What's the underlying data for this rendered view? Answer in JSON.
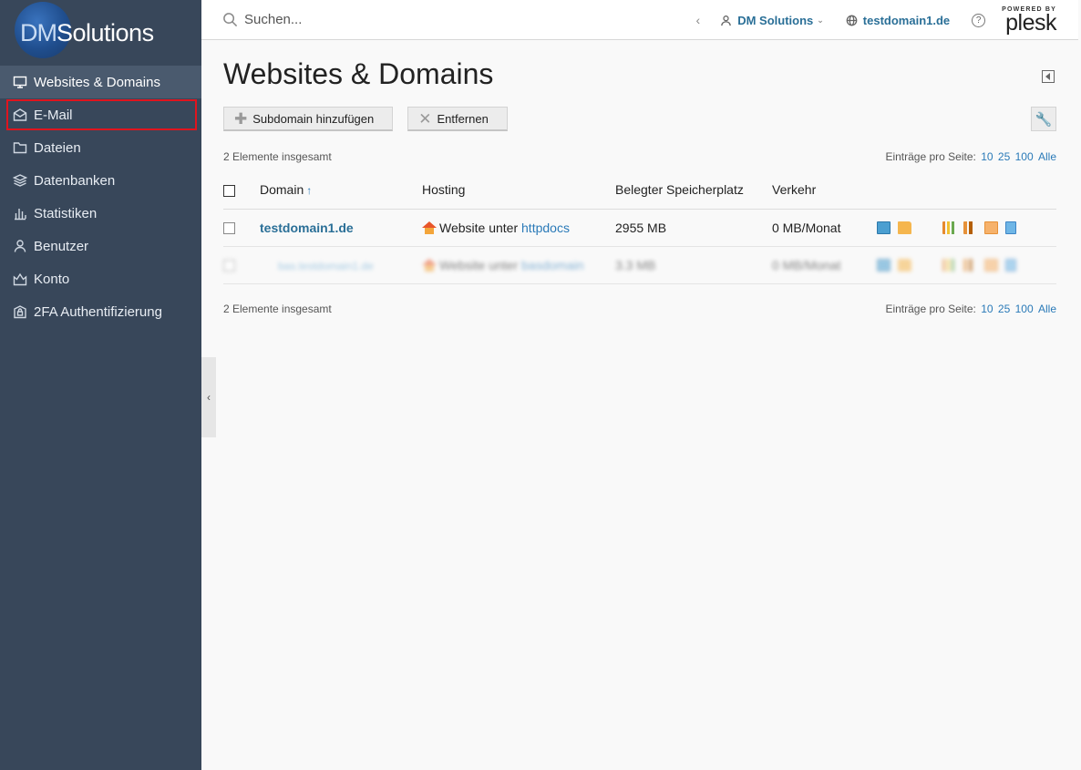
{
  "brand": {
    "logo_dm": "DM",
    "logo_solutions": "Solutions"
  },
  "sidebar": {
    "items": [
      {
        "label": "Websites & Domains",
        "icon": "monitor-icon",
        "active": true
      },
      {
        "label": "E-Mail",
        "icon": "envelope-icon",
        "highlighted": true
      },
      {
        "label": "Dateien",
        "icon": "folder-icon"
      },
      {
        "label": "Datenbanken",
        "icon": "database-icon"
      },
      {
        "label": "Statistiken",
        "icon": "bar-chart-icon"
      },
      {
        "label": "Benutzer",
        "icon": "user-icon"
      },
      {
        "label": "Konto",
        "icon": "account-icon"
      },
      {
        "label": "2FA Authentifizierung",
        "icon": "shield-lock-icon"
      }
    ]
  },
  "topbar": {
    "search_placeholder": "Suchen...",
    "account_name": "DM Solutions",
    "domain": "testdomain1.de",
    "help": "?",
    "powered_by": "POWERED BY",
    "plesk": "plesk"
  },
  "page": {
    "title": "Websites & Domains",
    "buttons": {
      "add_subdomain": "Subdomain hinzufügen",
      "remove": "Entfernen"
    },
    "total_top": "2 Elemente insgesamt",
    "total_bottom": "2 Elemente insgesamt",
    "per_page_label": "Einträge pro Seite:",
    "per_page_options": [
      "10",
      "25",
      "100",
      "Alle"
    ]
  },
  "table": {
    "columns": {
      "domain": "Domain",
      "hosting": "Hosting",
      "storage": "Belegter Speicherplatz",
      "traffic": "Verkehr"
    },
    "rows": [
      {
        "domain": "testdomain1.de",
        "hosting_prefix": "Website unter",
        "hosting_link": "httpdocs",
        "storage": "2955 MB",
        "traffic": "0 MB/Monat",
        "blurred": false
      },
      {
        "domain": "bas.testdomain1.de",
        "hosting_prefix": "Website unter",
        "hosting_link": "basdomain",
        "storage": "3.3 MB",
        "traffic": "0 MB/Monat",
        "blurred": true
      }
    ]
  },
  "colors": {
    "sidebar_bg": "#38475a",
    "link": "#2a6f97",
    "highlight_border": "#e0141e"
  }
}
